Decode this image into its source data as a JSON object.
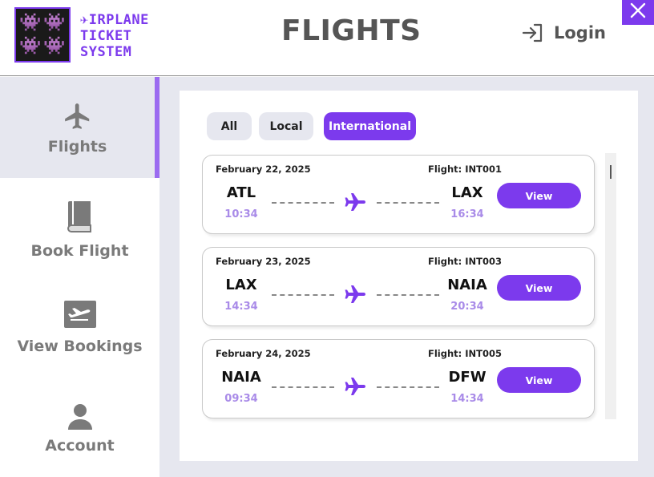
{
  "brand": {
    "line1": "✈IRPLANE",
    "line2": "TICKET",
    "line3": "SYSTEM",
    "accent_color": "#7c3aed"
  },
  "header": {
    "title": "FLIGHTS",
    "login_label": "Login"
  },
  "sidebar": {
    "items": [
      {
        "label": "Flights",
        "icon": "airplane-icon",
        "active": true
      },
      {
        "label": "Book Flight",
        "icon": "book-icon",
        "active": false
      },
      {
        "label": "View Bookings",
        "icon": "ticket-icon",
        "active": false
      },
      {
        "label": "Account",
        "icon": "user-icon",
        "active": false
      }
    ]
  },
  "filters": {
    "tabs": [
      {
        "label": "All",
        "selected": false
      },
      {
        "label": "Local",
        "selected": false
      },
      {
        "label": "International",
        "selected": true
      }
    ]
  },
  "flights": [
    {
      "date": "February 22, 2025",
      "flight": "Flight: INT001",
      "origin": "ATL",
      "origin_time": "10:34",
      "destination": "LAX",
      "destination_time": "16:34",
      "button": "View"
    },
    {
      "date": "February 23, 2025",
      "flight": "Flight: INT003",
      "origin": "LAX",
      "origin_time": "14:34",
      "destination": "NAIA",
      "destination_time": "20:34",
      "button": "View"
    },
    {
      "date": "February 24, 2025",
      "flight": "Flight: INT005",
      "origin": "NAIA",
      "origin_time": "09:34",
      "destination": "DFW",
      "destination_time": "14:34",
      "button": "View"
    }
  ]
}
